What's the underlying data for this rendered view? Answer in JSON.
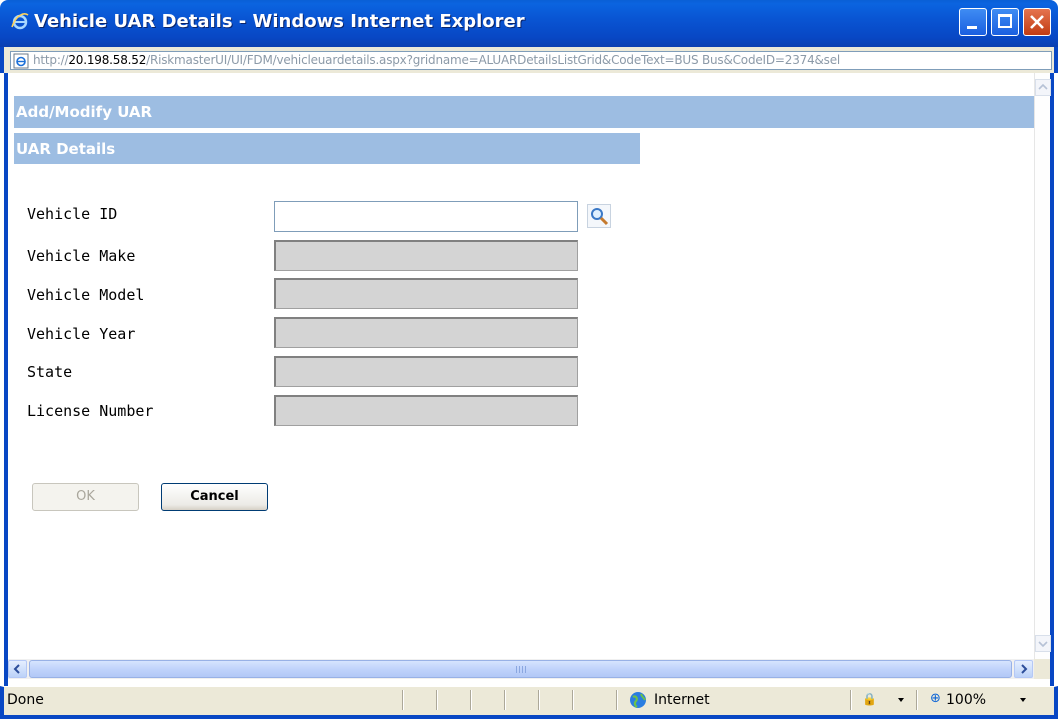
{
  "window": {
    "title": "Vehicle UAR Details - Windows Internet Explorer",
    "address_scheme": "http://",
    "address_host": "20.198.58.52",
    "address_path": "/RiskmasterUI/UI/FDM/vehicleuardetails.aspx?gridname=ALUARDetailsListGrid&CodeText=BUS Bus&CodeID=2374&sel"
  },
  "page": {
    "header_title": "Add/Modify UAR",
    "section_title": "UAR Details",
    "fields": [
      {
        "label": "Vehicle ID",
        "value": "",
        "disabled": false
      },
      {
        "label": "Vehicle Make",
        "value": "",
        "disabled": true
      },
      {
        "label": "Vehicle Model",
        "value": "",
        "disabled": true
      },
      {
        "label": "Vehicle Year",
        "value": "",
        "disabled": true
      },
      {
        "label": "State",
        "value": "",
        "disabled": true
      },
      {
        "label": "License Number",
        "value": "",
        "disabled": true
      }
    ],
    "ok_label": "OK",
    "cancel_label": "Cancel"
  },
  "statusbar": {
    "status_text": "Done",
    "zone_text": "Internet",
    "zoom_text": "100%"
  },
  "colors": {
    "header_bg": "#9dbde2",
    "titlebar": "#0955d3"
  },
  "icons": {
    "title": "ie-logo-icon",
    "lookup": "magnifier-icon",
    "zone": "globe-icon"
  }
}
